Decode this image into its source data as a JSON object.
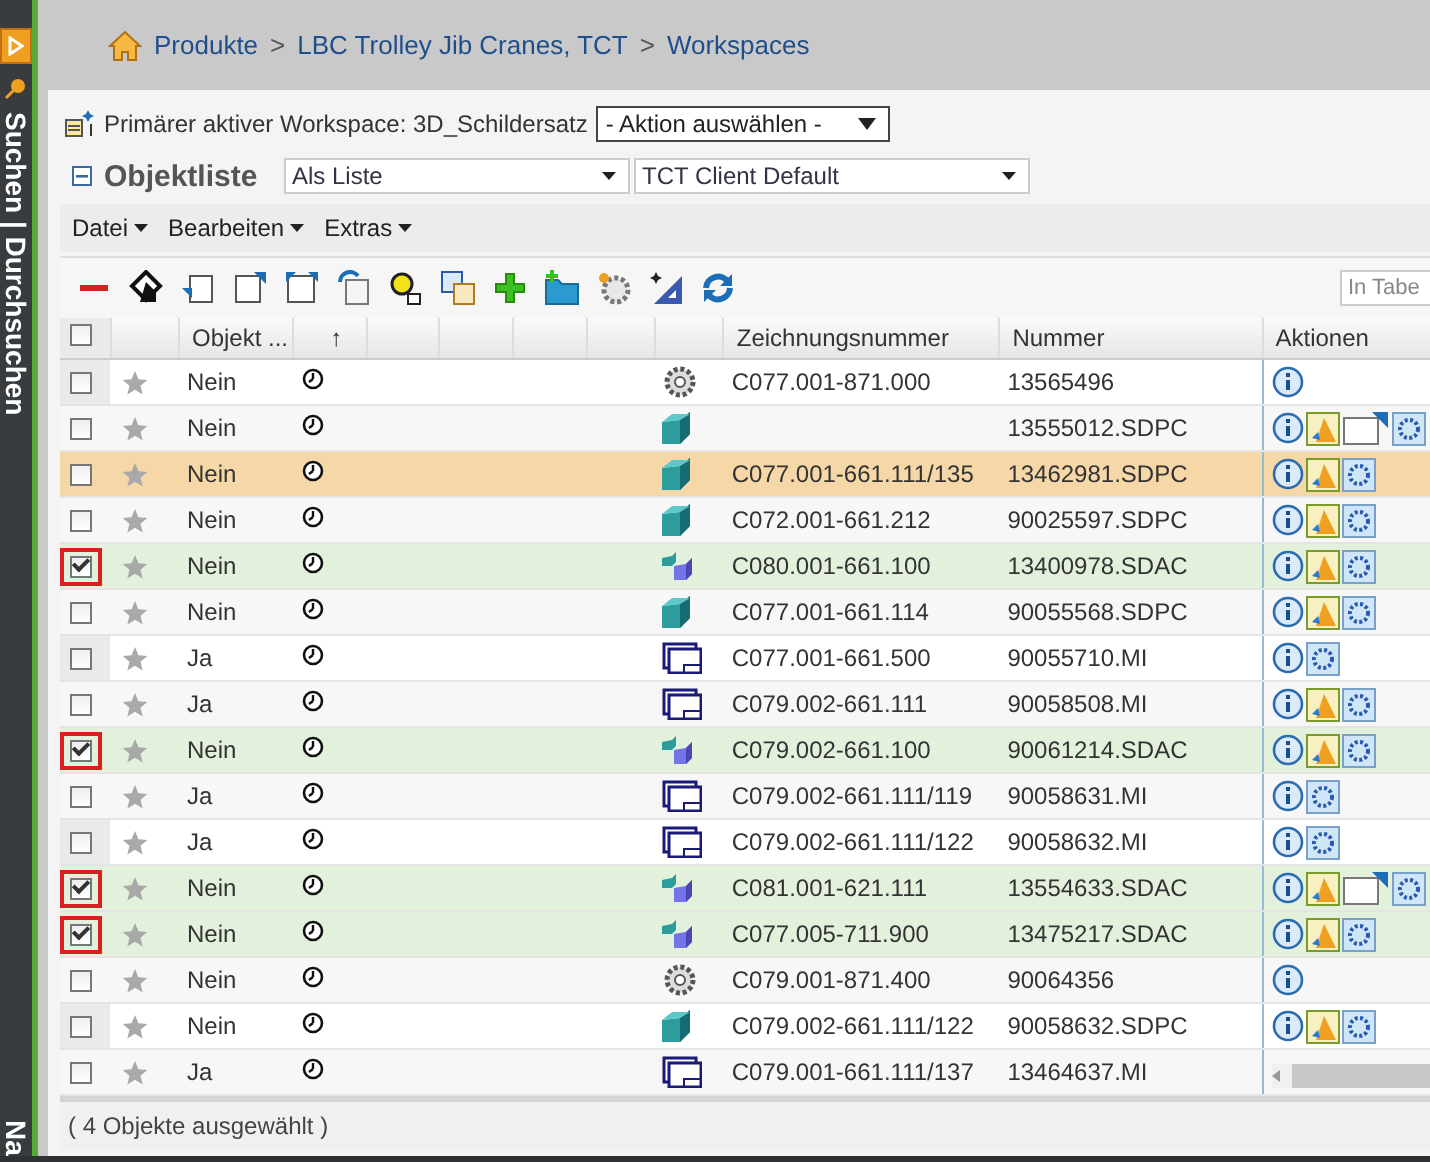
{
  "sidebar": {
    "title": "Suchen | Durchsuchen",
    "bottom_label": "Na"
  },
  "breadcrumb": [
    {
      "label": "Produkte"
    },
    {
      "label": "LBC Trolley Jib Cranes, TCT"
    },
    {
      "label": "Workspaces"
    }
  ],
  "breadcrumb_separator": ">",
  "workspace": {
    "label": "Primärer aktiver Workspace: 3D_Schildersatz",
    "action_select": "- Aktion auswählen -"
  },
  "objektliste": {
    "title": "Objektliste",
    "view_select": "Als Liste",
    "layout_select": "TCT Client Default"
  },
  "menu": [
    {
      "label": "Datei"
    },
    {
      "label": "Bearbeiten"
    },
    {
      "label": "Extras"
    }
  ],
  "toolbar": {
    "search_placeholder": "In Tabe"
  },
  "table": {
    "header_checked": false,
    "columns": [
      {
        "label": "Objekt ..."
      },
      {
        "label": "↑"
      },
      {
        "label": "Zeichnungsnummer"
      },
      {
        "label": "Nummer"
      },
      {
        "label": "Aktionen"
      }
    ],
    "rows": [
      {
        "checked": false,
        "outlined": false,
        "highlighted": false,
        "flag": "Nein",
        "icon": {
          "kind": "gear"
        },
        "drawing_no": "C077.001-871.000",
        "number": "13565496",
        "actions": [
          {
            "kind": "info"
          }
        ]
      },
      {
        "checked": false,
        "outlined": false,
        "highlighted": false,
        "flag": "Nein",
        "icon": {
          "kind": "part"
        },
        "number": "13555012.SDPC",
        "actions": [
          {
            "kind": "info"
          },
          {
            "kind": "viz"
          },
          {
            "kind": "doc"
          },
          {
            "kind": "config"
          }
        ]
      },
      {
        "checked": false,
        "outlined": false,
        "highlighted": true,
        "flag": "Nein",
        "icon": {
          "kind": "part"
        },
        "drawing_no": "C077.001-661.111/135",
        "number": "13462981.SDPC",
        "actions": [
          {
            "kind": "info"
          },
          {
            "kind": "viz"
          },
          {
            "kind": "config"
          }
        ]
      },
      {
        "checked": false,
        "outlined": false,
        "highlighted": false,
        "flag": "Nein",
        "icon": {
          "kind": "part"
        },
        "drawing_no": "C072.001-661.212",
        "number": "90025597.SDPC",
        "actions": [
          {
            "kind": "info"
          },
          {
            "kind": "viz"
          },
          {
            "kind": "config"
          }
        ]
      },
      {
        "checked": true,
        "outlined": true,
        "highlighted": false,
        "flag": "Nein",
        "icon": {
          "kind": "assembly"
        },
        "drawing_no": "C080.001-661.100",
        "number": "13400978.SDAC",
        "actions": [
          {
            "kind": "info"
          },
          {
            "kind": "viz"
          },
          {
            "kind": "config"
          }
        ]
      },
      {
        "checked": false,
        "outlined": false,
        "highlighted": false,
        "flag": "Nein",
        "icon": {
          "kind": "part"
        },
        "drawing_no": "C077.001-661.114",
        "number": "90055568.SDPC",
        "actions": [
          {
            "kind": "info"
          },
          {
            "kind": "viz"
          },
          {
            "kind": "config"
          }
        ]
      },
      {
        "checked": false,
        "outlined": false,
        "highlighted": false,
        "flag": "Ja",
        "icon": {
          "kind": "drawing"
        },
        "drawing_no": "C077.001-661.500",
        "number": "90055710.MI",
        "actions": [
          {
            "kind": "info"
          },
          {
            "kind": "config"
          }
        ]
      },
      {
        "checked": false,
        "outlined": false,
        "highlighted": false,
        "flag": "Ja",
        "icon": {
          "kind": "drawing"
        },
        "drawing_no": "C079.002-661.111",
        "number": "90058508.MI",
        "actions": [
          {
            "kind": "info"
          },
          {
            "kind": "viz"
          },
          {
            "kind": "config"
          }
        ]
      },
      {
        "checked": true,
        "outlined": true,
        "highlighted": false,
        "flag": "Nein",
        "icon": {
          "kind": "assembly"
        },
        "drawing_no": "C079.002-661.100",
        "number": "90061214.SDAC",
        "actions": [
          {
            "kind": "info"
          },
          {
            "kind": "viz"
          },
          {
            "kind": "config"
          }
        ]
      },
      {
        "checked": false,
        "outlined": false,
        "highlighted": false,
        "flag": "Ja",
        "icon": {
          "kind": "drawing"
        },
        "drawing_no": "C079.002-661.111/119",
        "number": "90058631.MI",
        "actions": [
          {
            "kind": "info"
          },
          {
            "kind": "config"
          }
        ]
      },
      {
        "checked": false,
        "outlined": false,
        "highlighted": false,
        "flag": "Ja",
        "icon": {
          "kind": "drawing"
        },
        "drawing_no": "C079.002-661.111/122",
        "number": "90058632.MI",
        "actions": [
          {
            "kind": "info"
          },
          {
            "kind": "config"
          }
        ]
      },
      {
        "checked": true,
        "outlined": true,
        "highlighted": false,
        "flag": "Nein",
        "icon": {
          "kind": "assembly"
        },
        "drawing_no": "C081.001-621.111",
        "number": "13554633.SDAC",
        "actions": [
          {
            "kind": "info"
          },
          {
            "kind": "viz"
          },
          {
            "kind": "doc"
          },
          {
            "kind": "config"
          }
        ]
      },
      {
        "checked": true,
        "outlined": true,
        "highlighted": false,
        "flag": "Nein",
        "icon": {
          "kind": "assembly"
        },
        "drawing_no": "C077.005-711.900",
        "number": "13475217.SDAC",
        "actions": [
          {
            "kind": "info"
          },
          {
            "kind": "viz"
          },
          {
            "kind": "config"
          }
        ]
      },
      {
        "checked": false,
        "outlined": false,
        "highlighted": false,
        "flag": "Nein",
        "icon": {
          "kind": "gear"
        },
        "drawing_no": "C079.001-871.400",
        "number": "90064356",
        "actions": [
          {
            "kind": "info"
          }
        ]
      },
      {
        "checked": false,
        "outlined": false,
        "highlighted": false,
        "flag": "Nein",
        "icon": {
          "kind": "part"
        },
        "drawing_no": "C079.002-661.111/122",
        "number": "90058632.SDPC",
        "actions": [
          {
            "kind": "info"
          },
          {
            "kind": "viz"
          },
          {
            "kind": "config"
          }
        ]
      },
      {
        "checked": false,
        "outlined": false,
        "highlighted": false,
        "flag": "Ja",
        "icon": {
          "kind": "drawing"
        },
        "drawing_no": "C079.001-661.111/137",
        "number": "13464637.MI"
      }
    ]
  },
  "status": "( 4 Objekte ausgewählt )"
}
